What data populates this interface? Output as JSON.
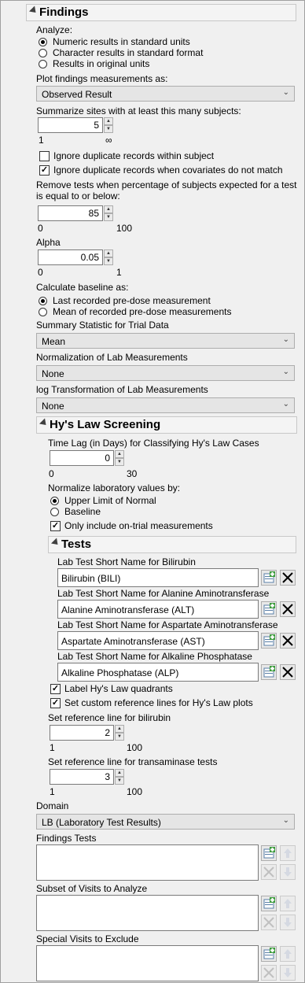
{
  "findings": {
    "title": "Findings",
    "analyze_label": "Analyze:",
    "analyze_options": [
      "Numeric results in standard units",
      "Character results in standard format",
      "Results in original units"
    ],
    "plot_label": "Plot findings measurements as:",
    "plot_value": "Observed Result",
    "summarize_label": "Summarize sites with at least this many subjects:",
    "summarize_value": "5",
    "summarize_min": "1",
    "summarize_max": "∞",
    "ignore_dup_label": "Ignore duplicate records within subject",
    "ignore_cov_label": "Ignore duplicate records when covariates do not match",
    "remove_label_1": "Remove tests when percentage of subjects expected for a test",
    "remove_label_2": "is equal to or below:",
    "remove_value": "85",
    "remove_min": "0",
    "remove_max": "100",
    "alpha_label": "Alpha",
    "alpha_value": "0.05",
    "alpha_min": "0",
    "alpha_max": "1",
    "baseline_label": "Calculate baseline as:",
    "baseline_options": [
      "Last recorded pre-dose measurement",
      "Mean of recorded pre-dose measurements"
    ],
    "summary_stat_label": "Summary Statistic for Trial Data",
    "summary_stat_value": "Mean",
    "normalization_label": "Normalization of Lab Measurements",
    "normalization_value": "None",
    "log_label": "log Transformation of Lab Measurements",
    "log_value": "None"
  },
  "hys": {
    "title": "Hy's Law Screening",
    "timelag_label": "Time Lag (in Days) for Classifying Hy's Law Cases",
    "timelag_value": "0",
    "timelag_min": "0",
    "timelag_max": "30",
    "normalize_label": "Normalize laboratory values by:",
    "normalize_options": [
      "Upper Limit of Normal",
      "Baseline"
    ],
    "ontrial_label": "Only include on-trial measurements",
    "tests": {
      "title": "Tests",
      "items": [
        {
          "label": "Lab Test Short Name for Bilirubin",
          "value": "Bilirubin (BILI)"
        },
        {
          "label": "Lab Test Short Name for Alanine Aminotransferase",
          "value": "Alanine Aminotransferase (ALT)"
        },
        {
          "label": "Lab Test Short Name for Aspartate Aminotransferase",
          "value": "Aspartate Aminotransferase (AST)"
        },
        {
          "label": "Lab Test Short Name for Alkaline Phosphatase",
          "value": "Alkaline Phosphatase (ALP)"
        }
      ]
    },
    "label_quadrants": "Label Hy's Law quadrants",
    "custom_ref": "Set custom reference lines for Hy's Law plots",
    "bili_ref_label": "Set reference line for bilirubin",
    "bili_ref_value": "2",
    "bili_ref_min": "1",
    "bili_ref_max": "100",
    "trans_ref_label": "Set reference line for transaminase tests",
    "trans_ref_value": "3",
    "trans_ref_min": "1",
    "trans_ref_max": "100"
  },
  "domain": {
    "label": "Domain",
    "value": "LB (Laboratory Test Results)"
  },
  "findings_tests_label": "Findings Tests",
  "subset_visits_label": "Subset of Visits to Analyze",
  "special_visits_label": "Special Visits to Exclude"
}
